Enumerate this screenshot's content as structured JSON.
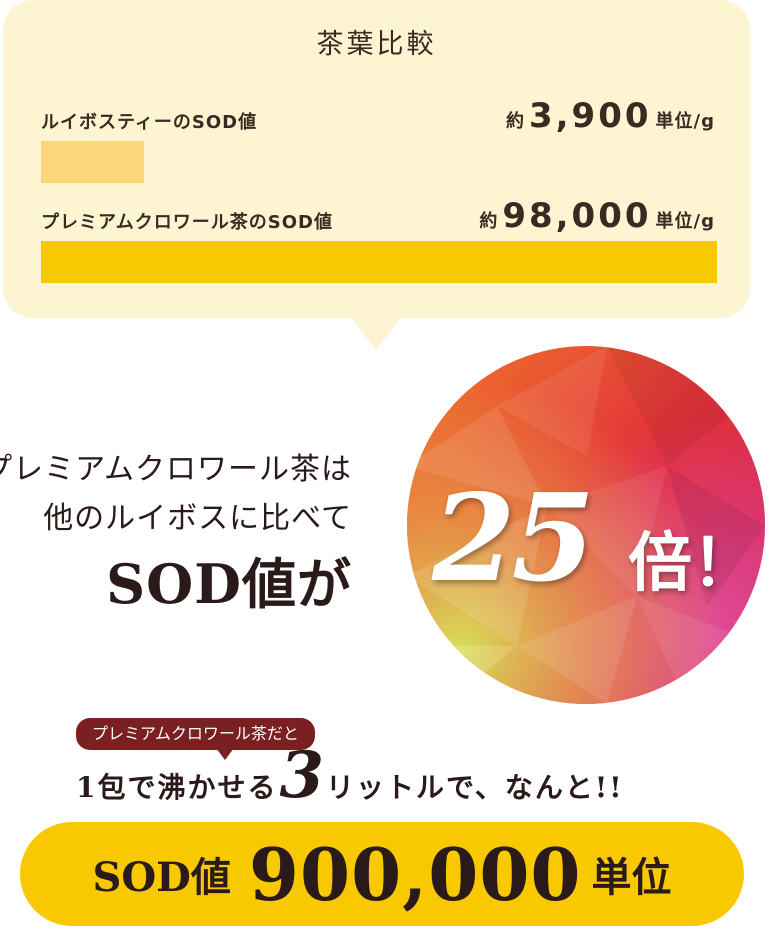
{
  "comparison": {
    "title": "茶葉比較",
    "rooibos": {
      "label": "ルイボスティーのSOD値",
      "prefix": "約",
      "value_text": "3,900",
      "unit": "単位/g",
      "color": "#fdd57a"
    },
    "premium": {
      "label": "プレミアムクロワール茶のSOD値",
      "prefix": "約",
      "value_text": "98,000",
      "unit": "単位/g",
      "color": "#f8c800"
    }
  },
  "chart_data": {
    "type": "bar",
    "categories": [
      "ルイボスティーのSOD値",
      "プレミアムクロワール茶のSOD値"
    ],
    "values": [
      3900,
      98000
    ],
    "unit": "単位/g"
  },
  "headline": {
    "line1": "プレミアムクロワール茶は",
    "line2": "他のルイボスに比べて",
    "line3": "SOD値が",
    "times_value": "25",
    "times_unit": "倍！"
  },
  "bottom": {
    "badge": "プレミアムクロワール茶だと",
    "claim_pre": "1包で沸かせる",
    "claim_number": "3",
    "claim_post": "リットルで、なんと!!",
    "result_label": "SOD値",
    "result_value": "900,000",
    "result_unit": "単位"
  },
  "colors": {
    "card_bg": "#fdf5d2",
    "accent_yellow": "#f8c800",
    "badge_red": "#7a1f22",
    "text_dark": "#2a1a1a"
  }
}
